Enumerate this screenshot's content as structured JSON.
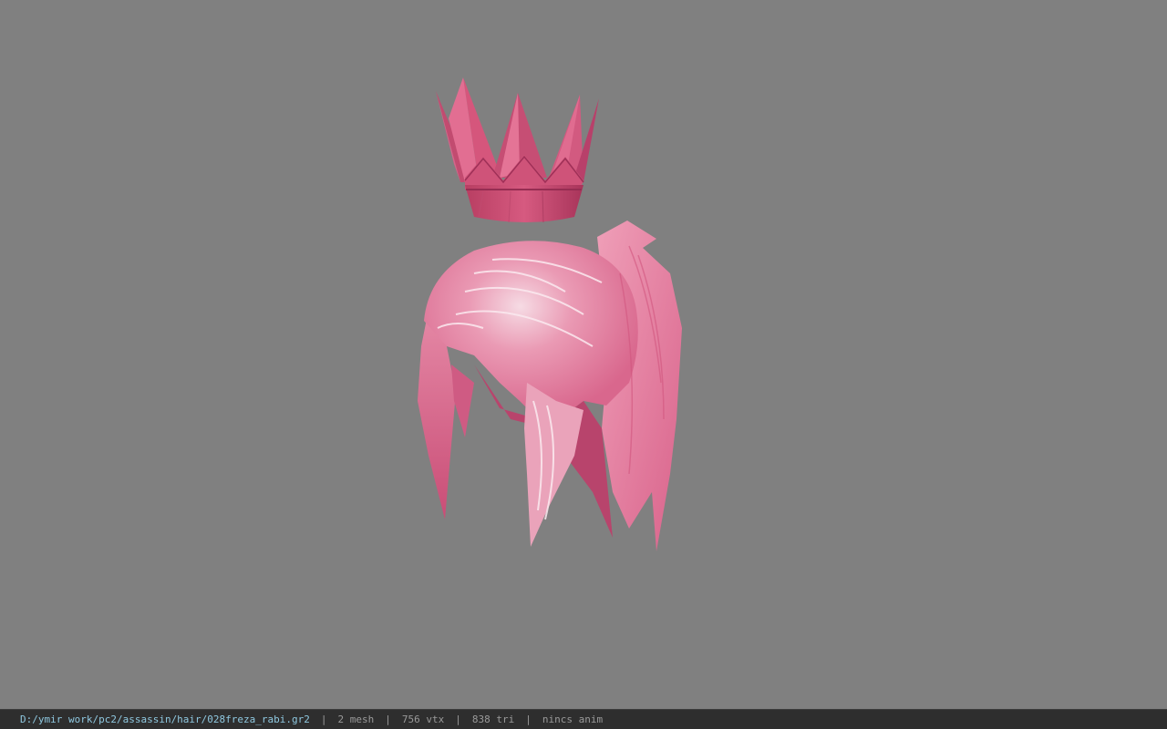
{
  "viewport": {
    "background": "#808080",
    "model_colors": {
      "crown": "#d4587c",
      "hair_base": "#e07a9a",
      "hair_highlight": "#f5d6df"
    },
    "model_name": "028freza_rabi"
  },
  "status_bar": {
    "file_path": "D:/ymir work/pc2/assassin/hair/028freza_rabi.gr2",
    "separator": "|",
    "mesh_count": "2 mesh",
    "vertex_count": "756 vtx",
    "triangle_count": "838 tri",
    "anim_status": "nincs anim"
  }
}
